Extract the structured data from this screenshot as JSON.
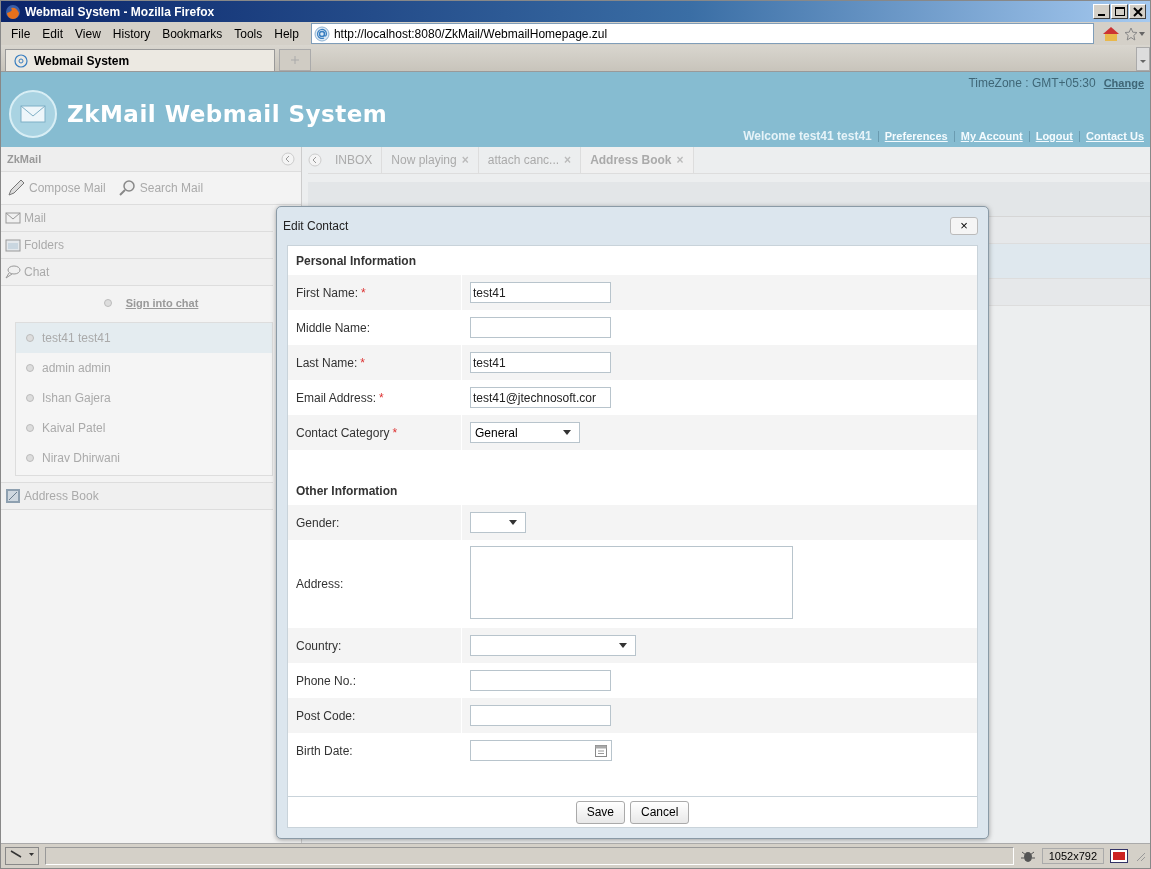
{
  "window": {
    "title": "Webmail System - Mozilla Firefox"
  },
  "menu": [
    "File",
    "Edit",
    "View",
    "History",
    "Bookmarks",
    "Tools",
    "Help"
  ],
  "address_bar": {
    "value": "http://localhost:8080/ZkMail/WebmailHomepage.zul"
  },
  "browser_tabs": [
    {
      "label": "Webmail System",
      "selected": true
    }
  ],
  "header": {
    "title": "ZkMail Webmail System",
    "timezone": "TimeZone : GMT+05:30",
    "timezone_link": "Change",
    "welcome": "Welcome test41 test41",
    "links": [
      "Preferences",
      "My Account",
      "Logout",
      "Contact Us"
    ]
  },
  "sidebar": {
    "title": "ZkMail",
    "actions": [
      {
        "kind": "compose",
        "label": "Compose Mail"
      },
      {
        "kind": "search",
        "label": "Search Mail"
      }
    ],
    "sections": [
      {
        "kind": "mail",
        "label": "Mail"
      },
      {
        "kind": "folder",
        "label": "Folders"
      },
      {
        "kind": "chat",
        "label": "Chat"
      }
    ],
    "sign_in": "Sign into chat",
    "contacts": [
      {
        "name": "test41 test41",
        "selected": true
      },
      {
        "name": "admin admin",
        "selected": false
      },
      {
        "name": "Ishan Gajera",
        "selected": false
      },
      {
        "name": "Kaival Patel",
        "selected": false
      },
      {
        "name": "Nirav Dhirwani",
        "selected": false
      }
    ],
    "address_book": "Address Book"
  },
  "content_tabs": [
    {
      "label": "INBOX",
      "selected": false
    },
    {
      "label": "Now playing",
      "close": "×",
      "selected": false
    },
    {
      "label": "attach canc...",
      "close": "×",
      "selected": false
    },
    {
      "label": "Address Book",
      "close": "×",
      "selected": true
    }
  ],
  "dialog": {
    "title": "Edit Contact",
    "close": "×",
    "sections": [
      {
        "heading": "Personal Information",
        "fields": [
          {
            "label": "First Name:",
            "required_mark": "*",
            "kind": "text",
            "value": "test41"
          },
          {
            "label": "Middle Name:",
            "kind": "text"
          },
          {
            "label": "Last Name:",
            "required_mark": "*",
            "kind": "text",
            "value": "test41"
          },
          {
            "label": "Email Address:",
            "required_mark": "*",
            "kind": "text",
            "value": "test41@jtechnosoft.cor"
          },
          {
            "label": "Contact Category",
            "required_mark": "*",
            "kind": "select",
            "value": "General"
          }
        ]
      },
      {
        "heading": "Other Information",
        "fields": [
          {
            "label": "Gender:",
            "kind": "small-select"
          },
          {
            "label": "Address:",
            "kind": "textarea"
          },
          {
            "label": "Country:",
            "kind": "wide-select"
          },
          {
            "label": "Phone No.:",
            "kind": "text"
          },
          {
            "label": "Post Code:",
            "kind": "text"
          },
          {
            "label": "Birth Date:",
            "kind": "date"
          }
        ]
      }
    ],
    "buttons": [
      "Save",
      "Cancel"
    ]
  },
  "status_bar": {
    "size": "1052x792"
  }
}
